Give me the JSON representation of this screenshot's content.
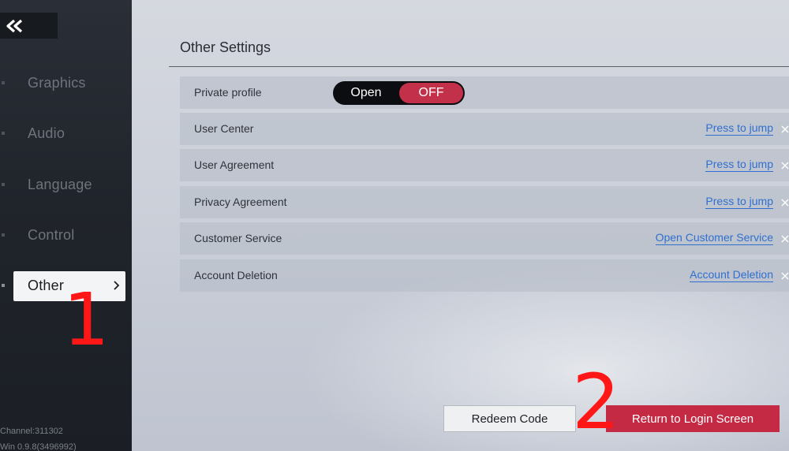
{
  "sidebar": {
    "items": [
      {
        "label": "Graphics"
      },
      {
        "label": "Audio"
      },
      {
        "label": "Language"
      },
      {
        "label": "Control"
      },
      {
        "label": "Other"
      }
    ],
    "footer": {
      "channel": "Channel:311302",
      "version": "Win 0.9.8(3496992)"
    }
  },
  "main": {
    "section_title": "Other Settings",
    "private_profile": {
      "label": "Private profile",
      "option_open": "Open",
      "option_off": "OFF"
    },
    "rows": [
      {
        "label": "User Center",
        "action": "Press to jump"
      },
      {
        "label": "User Agreement",
        "action": "Press to jump"
      },
      {
        "label": "Privacy Agreement",
        "action": "Press to jump"
      },
      {
        "label": "Customer Service",
        "action": "Open Customer Service"
      },
      {
        "label": "Account Deletion",
        "action": "Account Deletion"
      }
    ],
    "buttons": {
      "redeem": "Redeem Code",
      "return_login": "Return to Login Screen"
    }
  },
  "annotations": {
    "first": "1",
    "second": "2"
  },
  "colors": {
    "accent_red": "#c52a45",
    "link_blue": "#2f6fd0",
    "annotation_red": "#ff1616"
  },
  "icons": [
    "double-chevron-left-icon",
    "chevron-right-icon",
    "close-x-icon"
  ]
}
